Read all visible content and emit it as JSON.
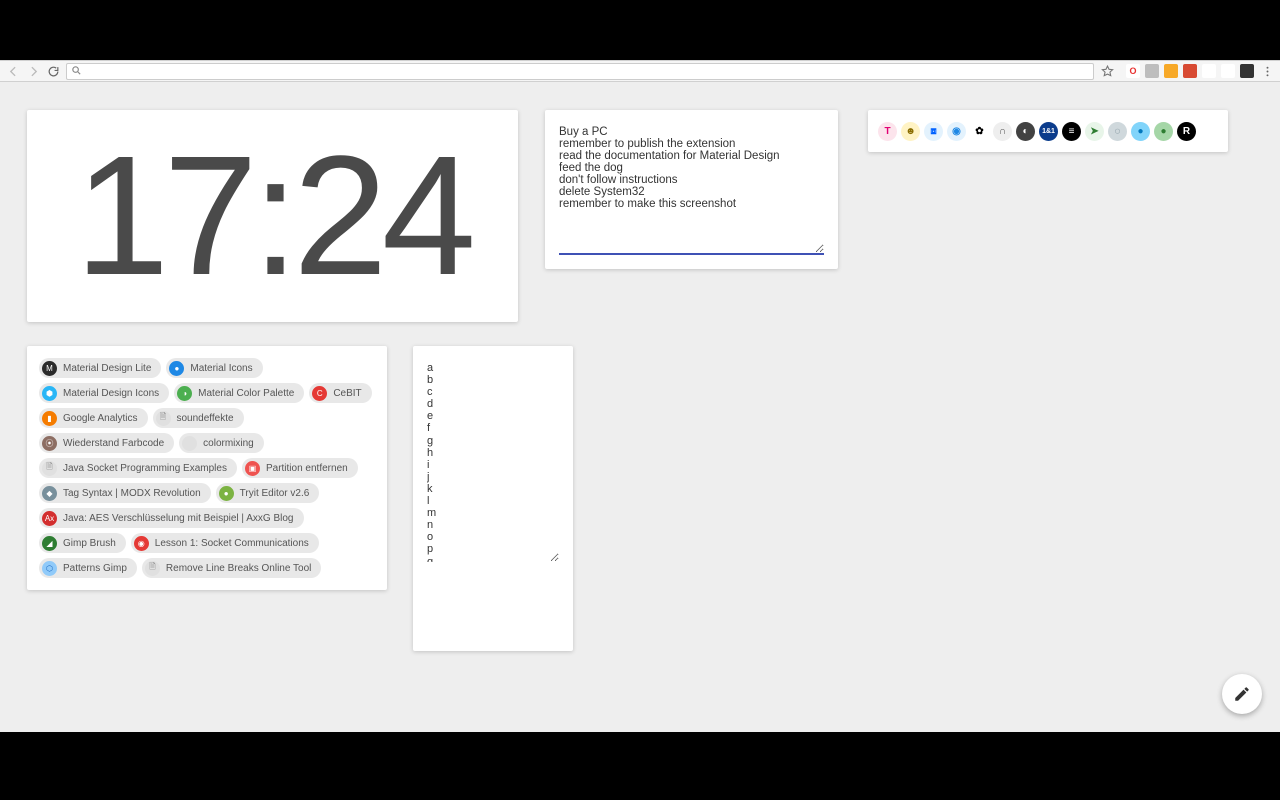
{
  "toolbar": {
    "ext_icons": [
      {
        "name": "opera-icon",
        "bg": "#fff",
        "fg": "#e8302f",
        "glyph": "O"
      },
      {
        "name": "ext2-icon",
        "bg": "#bdbdbd",
        "fg": "#fff",
        "glyph": ""
      },
      {
        "name": "ext3-icon",
        "bg": "#f7a928",
        "fg": "#fff",
        "glyph": ""
      },
      {
        "name": "ext4-icon",
        "bg": "#d84a33",
        "fg": "#fff",
        "glyph": ""
      },
      {
        "name": "ext5-icon",
        "bg": "#fff",
        "fg": "#555",
        "glyph": ""
      },
      {
        "name": "ext6-icon",
        "bg": "#fff",
        "fg": "#555",
        "glyph": ""
      },
      {
        "name": "ext7-icon",
        "bg": "#333",
        "fg": "#fff",
        "glyph": ""
      }
    ]
  },
  "clock": {
    "time": "17:24"
  },
  "notes": {
    "text": "Buy a PC\nremember to publish the extension\nread the documentation for Material Design\nfeed the dog\ndon't follow instructions\ndelete System32\nremember to make this screenshot"
  },
  "apps": [
    {
      "name": "telekom",
      "bg": "#fce4ec",
      "fg": "#e20074",
      "glyph": "T"
    },
    {
      "name": "app2",
      "bg": "#fff3c4",
      "fg": "#8a6d00",
      "glyph": "☻"
    },
    {
      "name": "dropbox",
      "bg": "#e3f2fd",
      "fg": "#0061ff",
      "glyph": "⧈"
    },
    {
      "name": "app4",
      "bg": "#e3f2fd",
      "fg": "#1e88e5",
      "glyph": "◉"
    },
    {
      "name": "google-photos",
      "bg": "#fff",
      "fg": "#000",
      "glyph": "✿"
    },
    {
      "name": "app6",
      "bg": "#eeeeee",
      "fg": "#555",
      "glyph": "∩"
    },
    {
      "name": "app7",
      "bg": "#424242",
      "fg": "#fff",
      "glyph": "◐"
    },
    {
      "name": "1und1",
      "bg": "#0b3c8c",
      "fg": "#fff",
      "glyph": "1&1"
    },
    {
      "name": "app9",
      "bg": "#000",
      "fg": "#fff",
      "glyph": "≡"
    },
    {
      "name": "app10",
      "bg": "#e8f5e9",
      "fg": "#2e7d32",
      "glyph": "➤"
    },
    {
      "name": "app11",
      "bg": "#cfd8dc",
      "fg": "#546e7a",
      "glyph": "◌"
    },
    {
      "name": "app12",
      "bg": "#81d4fa",
      "fg": "#0277bd",
      "glyph": "●"
    },
    {
      "name": "app13",
      "bg": "#a5d6a7",
      "fg": "#2e7d32",
      "glyph": "●"
    },
    {
      "name": "app14",
      "bg": "#000",
      "fg": "#fff",
      "glyph": "R"
    }
  ],
  "bookmarks": [
    {
      "label": "Material Design Lite",
      "icon_bg": "#2b2b2b",
      "icon_fg": "#fff",
      "glyph": "M"
    },
    {
      "label": "Material Icons",
      "icon_bg": "#1e88e5",
      "icon_fg": "#fff",
      "glyph": "●"
    },
    {
      "label": "Material Design Icons",
      "icon_bg": "#29b6f6",
      "icon_fg": "#fff",
      "glyph": "⬢"
    },
    {
      "label": "Material Color Palette",
      "icon_bg": "#4caf50",
      "icon_fg": "#fff",
      "glyph": "◑"
    },
    {
      "label": "CeBIT",
      "icon_bg": "#e53935",
      "icon_fg": "#fff",
      "glyph": "C"
    },
    {
      "label": "Google Analytics",
      "icon_bg": "#f57c00",
      "icon_fg": "#fff",
      "glyph": "▮"
    },
    {
      "label": "soundeffekte",
      "icon_bg": "#e0e0e0",
      "icon_fg": "#777",
      "glyph": "🗎"
    },
    {
      "label": "Wiederstand Farbcode",
      "icon_bg": "#8d6e63",
      "icon_fg": "#fff",
      "glyph": "⦿"
    },
    {
      "label": "colormixing",
      "icon_bg": "#e0e0e0",
      "icon_fg": "#777",
      "glyph": ""
    },
    {
      "label": "Java Socket Programming Examples",
      "icon_bg": "#e0e0e0",
      "icon_fg": "#777",
      "glyph": "🗎"
    },
    {
      "label": "Partition entfernen",
      "icon_bg": "#ef5350",
      "icon_fg": "#fff",
      "glyph": "▣"
    },
    {
      "label": "Tag Syntax | MODX Revolution",
      "icon_bg": "#78909c",
      "icon_fg": "#fff",
      "glyph": "◆"
    },
    {
      "label": "Tryit Editor v2.6",
      "icon_bg": "#7cb342",
      "icon_fg": "#fff",
      "glyph": "●"
    },
    {
      "label": "Java: AES Verschlüsselung mit Beispiel | AxxG Blog",
      "icon_bg": "#d32f2f",
      "icon_fg": "#fff",
      "glyph": "Ax"
    },
    {
      "label": "Gimp Brush",
      "icon_bg": "#2e7d32",
      "icon_fg": "#fff",
      "glyph": "◢"
    },
    {
      "label": "Lesson 1: Socket Communications",
      "icon_bg": "#e53935",
      "icon_fg": "#fff",
      "glyph": "◉"
    },
    {
      "label": "Patterns Gimp",
      "icon_bg": "#90caf9",
      "icon_fg": "#1565c0",
      "glyph": "⬡"
    },
    {
      "label": "Remove Line Breaks Online Tool",
      "icon_bg": "#e0e0e0",
      "icon_fg": "#777",
      "glyph": "🗎"
    }
  ],
  "alpha": {
    "text": "a\nb\nc\nd\ne\nf\ng\nh\ni\nj\nk\nl\nm\nn\no\np\nq\nr\ns"
  }
}
